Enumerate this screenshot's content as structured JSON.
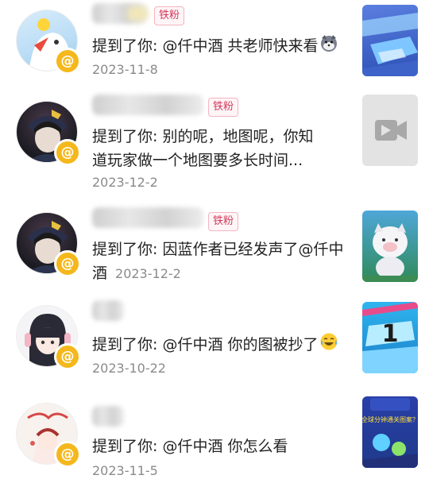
{
  "notifications": [
    {
      "tag": "铁粉",
      "message": "提到了你: @仟中酒 共老师快来看",
      "emoji": "husky-emoji",
      "date": "2023-11-8",
      "thumbnail": "game-level-thumbnail"
    },
    {
      "tag": "铁粉",
      "message_line1": "提到了你: 别的呢，地图呢，你知",
      "message_line2": "道玩家做一个地图要多长时间...",
      "date": "2023-12-2",
      "thumbnail": "video-placeholder-icon"
    },
    {
      "tag": "铁粉",
      "message_line1": "提到了你: 因蓝作者已经发声了@仟中",
      "message_line2": "酒",
      "date": "2023-12-2",
      "thumbnail": "cat-character-thumbnail"
    },
    {
      "message": "提到了你: @仟中酒 你的图被抄了",
      "emoji": "laughing-tears-emoji",
      "date": "2023-10-22",
      "thumbnail": "level-number-thumbnail"
    },
    {
      "message": "提到了你: @仟中酒 你怎么看",
      "date": "2023-11-5",
      "thumbnail": "ball-level-thumbnail"
    }
  ],
  "badge_symbol": "@",
  "thumb3_text": "1",
  "thumb4_text": "全球分钟通关图案？",
  "colors": {
    "badge": "#f5b81c",
    "tag_text": "#d23b5b",
    "date": "#8a8a8a"
  }
}
